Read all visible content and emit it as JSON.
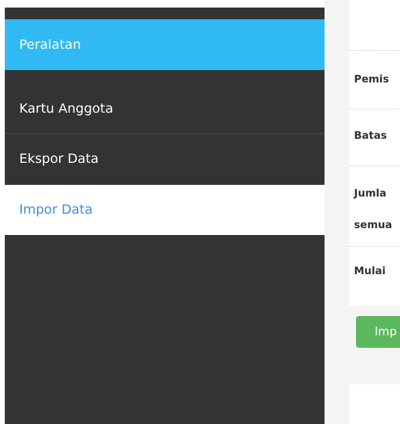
{
  "sidebar": {
    "items": [
      {
        "label": "Peralatan",
        "state": "active"
      },
      {
        "label": "Kartu Anggota",
        "state": "normal"
      },
      {
        "label": "Ekspor Data",
        "state": "normal"
      },
      {
        "label": "Impor Data",
        "state": "current"
      }
    ]
  },
  "form": {
    "rows": [
      {
        "label": "Pemis"
      },
      {
        "label": "Batas"
      },
      {
        "label": "Jumla"
      },
      {
        "label": "semua"
      },
      {
        "label": "Mulai"
      }
    ],
    "submit_label": "Imp"
  },
  "colors": {
    "sidebar_bg": "#333333",
    "active_bg": "#31b9f4",
    "current_text": "#3c8ddc",
    "button_bg": "#5cb85c",
    "gutter_bg": "#f4f4f4"
  }
}
